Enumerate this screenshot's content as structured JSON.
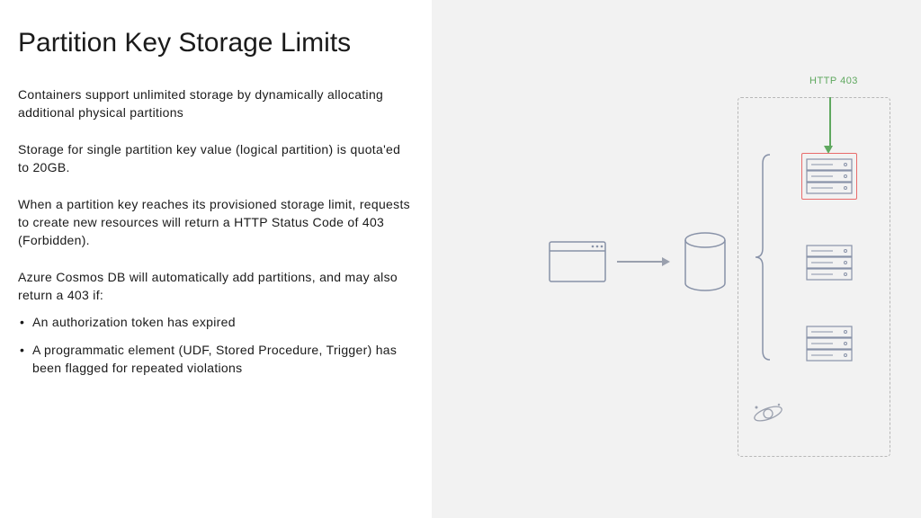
{
  "title": "Partition Key Storage Limits",
  "p1": "Containers support unlimited storage by dynamically allocating additional physical partitions",
  "p2": "Storage for single partition key value (logical partition) is quota'ed to 20GB.",
  "p3": "When a partition key reaches its provisioned storage limit, requests to create new resources will return a HTTP Status Code of 403 (Forbidden).",
  "p4": "Azure Cosmos DB will automatically add partitions, and may also return a 403 if:",
  "b1": "An authorization token has expired",
  "b2": "A programmatic element (UDF, Stored Procedure, Trigger) has been flagged for repeated violations",
  "httpLabel": "HTTP 403"
}
